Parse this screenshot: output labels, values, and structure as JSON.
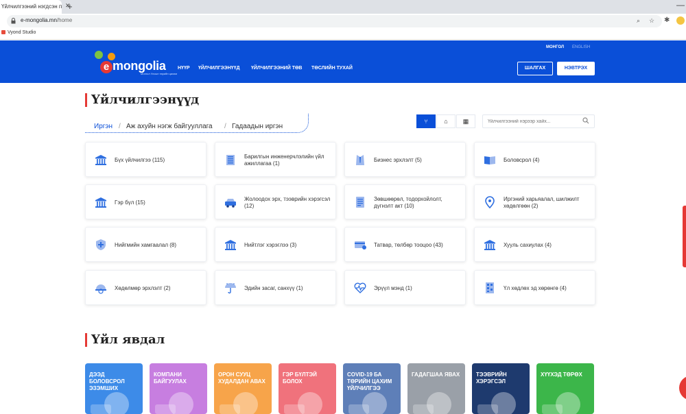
{
  "browser": {
    "tab_title": "Үйлчилгээний нэгдсэн п...",
    "url_host": "e-mongolia.mn",
    "url_path": "/home",
    "bookmark": "Vyond Studio"
  },
  "header": {
    "logo_text": "mongolia",
    "logo_e": "e",
    "logo_tagline": "Монгол Улсын төрийн цахим",
    "lang_active": "МОНГОЛ",
    "lang_other": "ENGLISH",
    "nav": [
      "НҮҮР",
      "ҮЙЛЧИЛГЭЭНҮҮД",
      "ҮЙЛЧИЛГЭЭНИЙ ТӨВ",
      "ТӨСЛИЙН ТУХАЙ"
    ],
    "search_label": "ШАЛГАХ",
    "login_label": "НЭВТРЭХ",
    "brand_color": "#0a4fd8"
  },
  "services": {
    "title": "Үйлчилгээнүүд",
    "crumbs": [
      "Иргэн",
      "Аж ахуйн нэгж байгууллага",
      "Гадаадын иргэн"
    ],
    "search_placeholder": "Үйлчилгээний нэрээр хайх...",
    "cards": [
      {
        "label": "Бүх үйлчилгээ (115)",
        "icon": "building-columns-icon"
      },
      {
        "label": "Барилгын инженерчлэлийн үйл ажиллагаа (1)",
        "icon": "office-building-icon"
      },
      {
        "label": "Бизнес эрхлэлт (5)",
        "icon": "suit-icon"
      },
      {
        "label": "Боловсрол (4)",
        "icon": "open-book-icon"
      },
      {
        "label": "Гэр бүл (15)",
        "icon": "building-columns-icon"
      },
      {
        "label": "Жолоодох эрх, тээврийн хэрэгсэл (12)",
        "icon": "car-icon"
      },
      {
        "label": "Зөвшөөрөл, тодорхойлолт, дүгнэлт акт (10)",
        "icon": "document-icon"
      },
      {
        "label": "Иргэний харьяалал, шилжилт хөдөлгөөн (2)",
        "icon": "location-pin-icon"
      },
      {
        "label": "Нийгмийн хамгаалал (8)",
        "icon": "shield-plus-icon"
      },
      {
        "label": "Нийтлэг хэрэглээ (3)",
        "icon": "building-columns-icon"
      },
      {
        "label": "Татвар, төлбөр тооцоо (43)",
        "icon": "credit-card-icon"
      },
      {
        "label": "Хууль сахиулах (4)",
        "icon": "building-columns-icon"
      },
      {
        "label": "Хөдөлмөр эрхлэлт (2)",
        "icon": "hard-hat-icon"
      },
      {
        "label": "Эдийн засаг, санхүү (1)",
        "icon": "umbrella-icon"
      },
      {
        "label": "Эрүүл мэнд (1)",
        "icon": "heartbeat-icon"
      },
      {
        "label": "Үл хөдлөх эд хөрөнгө (4)",
        "icon": "qr-building-icon"
      }
    ]
  },
  "events": {
    "title": "Үйл явдал",
    "items": [
      {
        "label": "ДЭЭД БОЛОВСРОЛ ЭЗЭМШИХ",
        "color": "#3d8be8"
      },
      {
        "label": "КОМПАНИ БАЙГУУЛАХ",
        "color": "#c77ee0"
      },
      {
        "label": "ОРОН СУУЦ ХУДАЛДАН АВАХ",
        "color": "#f7a44a"
      },
      {
        "label": "ГЭР БҮЛТЭЙ БОЛОХ",
        "color": "#f0727c"
      },
      {
        "label": "COVID-19 БА ТӨРИЙН ЦАХИМ ҮЙЛЧИЛГЭЭ",
        "color": "#5e7fb8"
      },
      {
        "label": "ГАДАГШАА ЯВАХ",
        "color": "#9aa0a8"
      },
      {
        "label": "ТЭЭВРИЙН ХЭРЭГСЭЛ",
        "color": "#1e3a6e"
      },
      {
        "label": "ХҮҮХЭД ТӨРӨХ",
        "color": "#3cb64a"
      }
    ]
  }
}
